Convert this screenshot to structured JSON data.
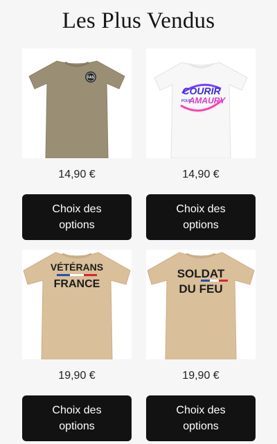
{
  "section": {
    "title": "Les Plus Vendus"
  },
  "products": [
    {
      "price": "14,90 €",
      "button_label": "Choix des options",
      "shirt_color": "#9a8f75",
      "badge_text": "FAS"
    },
    {
      "price": "14,90 €",
      "button_label": "Choix des options",
      "shirt_color": "#f7f7f7",
      "print_line1": "COURIR",
      "print_small": "POUR",
      "print_line2": "AMAURY"
    },
    {
      "price": "19,90 €",
      "button_label": "Choix des options",
      "shirt_color": "#d9bf9a",
      "print_line1": "VÉTÉRANS",
      "print_line2": "FRANCE"
    },
    {
      "price": "19,90 €",
      "button_label": "Choix des options",
      "shirt_color": "#d9bf9a",
      "print_line1": "SOLDAT",
      "print_line2": "DU FEU"
    }
  ]
}
